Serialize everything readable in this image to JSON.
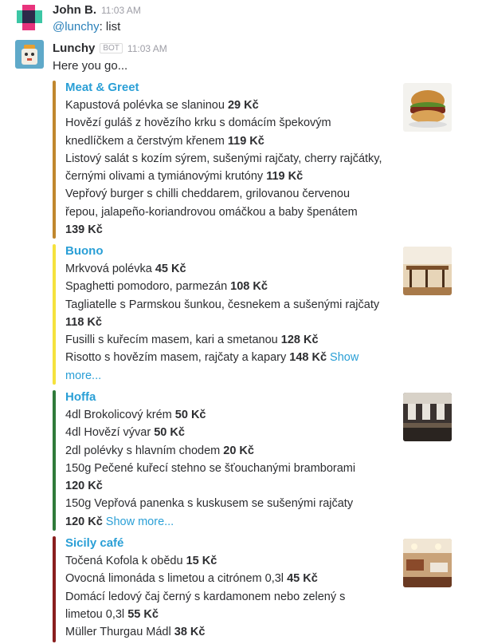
{
  "messages": [
    {
      "sender": "John B.",
      "time": "11:03 AM",
      "mention": "@lunchy",
      "text": ": list"
    },
    {
      "sender": "Lunchy",
      "badge": "BOT",
      "time": "11:03 AM",
      "text": "Here you go..."
    }
  ],
  "restaurants": [
    {
      "name": "Meat & Greet",
      "bar_color": "#c0872e",
      "lines": [
        {
          "text": "Kapustová polévka se slaninou ",
          "price": "29 Kč"
        },
        {
          "text": "Hovězí guláš z hovězího krku s domácím špekovým",
          "price": ""
        },
        {
          "text": "knedlíčkem a čerstvým křenem ",
          "price": "119 Kč"
        },
        {
          "text": "Listový salát s kozím sýrem, sušenými rajčaty, cherry rajčátky,",
          "price": ""
        },
        {
          "text": "černými olivami a tymiánovými krutóny ",
          "price": "119 Kč"
        },
        {
          "text": "Vepřový burger s chilli cheddarem, grilovanou červenou",
          "price": ""
        },
        {
          "text": "řepou, jalapeño-koriandrovou omáčkou a baby špenátem",
          "price": ""
        },
        {
          "text": "",
          "price": "139 Kč"
        }
      ]
    },
    {
      "name": "Buono",
      "bar_color": "#f5e23d",
      "lines": [
        {
          "text": "Mrkvová polévka ",
          "price": "45 Kč"
        },
        {
          "text": "Spaghetti pomodoro, parmezán ",
          "price": "108 Kč"
        },
        {
          "text": "Tagliatelle s Parmskou šunkou, česnekem a sušenými rajčaty",
          "price": ""
        },
        {
          "text": "",
          "price": "118 Kč"
        },
        {
          "text": "Fusilli s kuřecím masem, kari a smetanou ",
          "price": "128 Kč"
        },
        {
          "text": "Risotto s hovězím masem, rajčaty a kapary ",
          "price": "148 Kč",
          "more": " Show"
        },
        {
          "text": "",
          "price": "",
          "more": "more..."
        }
      ]
    },
    {
      "name": "Hoffa",
      "bar_color": "#2f7a3a",
      "lines": [
        {
          "text": "4dl Brokolicový krém ",
          "price": "50 Kč"
        },
        {
          "text": "4dl Hovězí vývar ",
          "price": "50 Kč"
        },
        {
          "text": "2dl polévky s hlavním chodem ",
          "price": "20 Kč"
        },
        {
          "text": "150g Pečené kuřecí stehno se šťouchanými bramborami",
          "price": ""
        },
        {
          "text": "",
          "price": "120 Kč"
        },
        {
          "text": "150g Vepřová panenka s kuskusem se sušenými rajčaty",
          "price": ""
        },
        {
          "text": "",
          "price": "120 Kč",
          "more": " Show more..."
        }
      ]
    },
    {
      "name": "Sicily café",
      "bar_color": "#8a1f1f",
      "lines": [
        {
          "text": "Točená Kofola k obědu ",
          "price": "15 Kč"
        },
        {
          "text": "Ovocná limonáda s limetou a citrónem 0,3l ",
          "price": "45 Kč"
        },
        {
          "text": "Domácí ledový čaj černý s kardamonem nebo zelený s",
          "price": ""
        },
        {
          "text": "limetou 0,3l ",
          "price": "55 Kč"
        },
        {
          "text": "Müller Thurgau Mádl ",
          "price": "38 Kč"
        }
      ]
    }
  ]
}
